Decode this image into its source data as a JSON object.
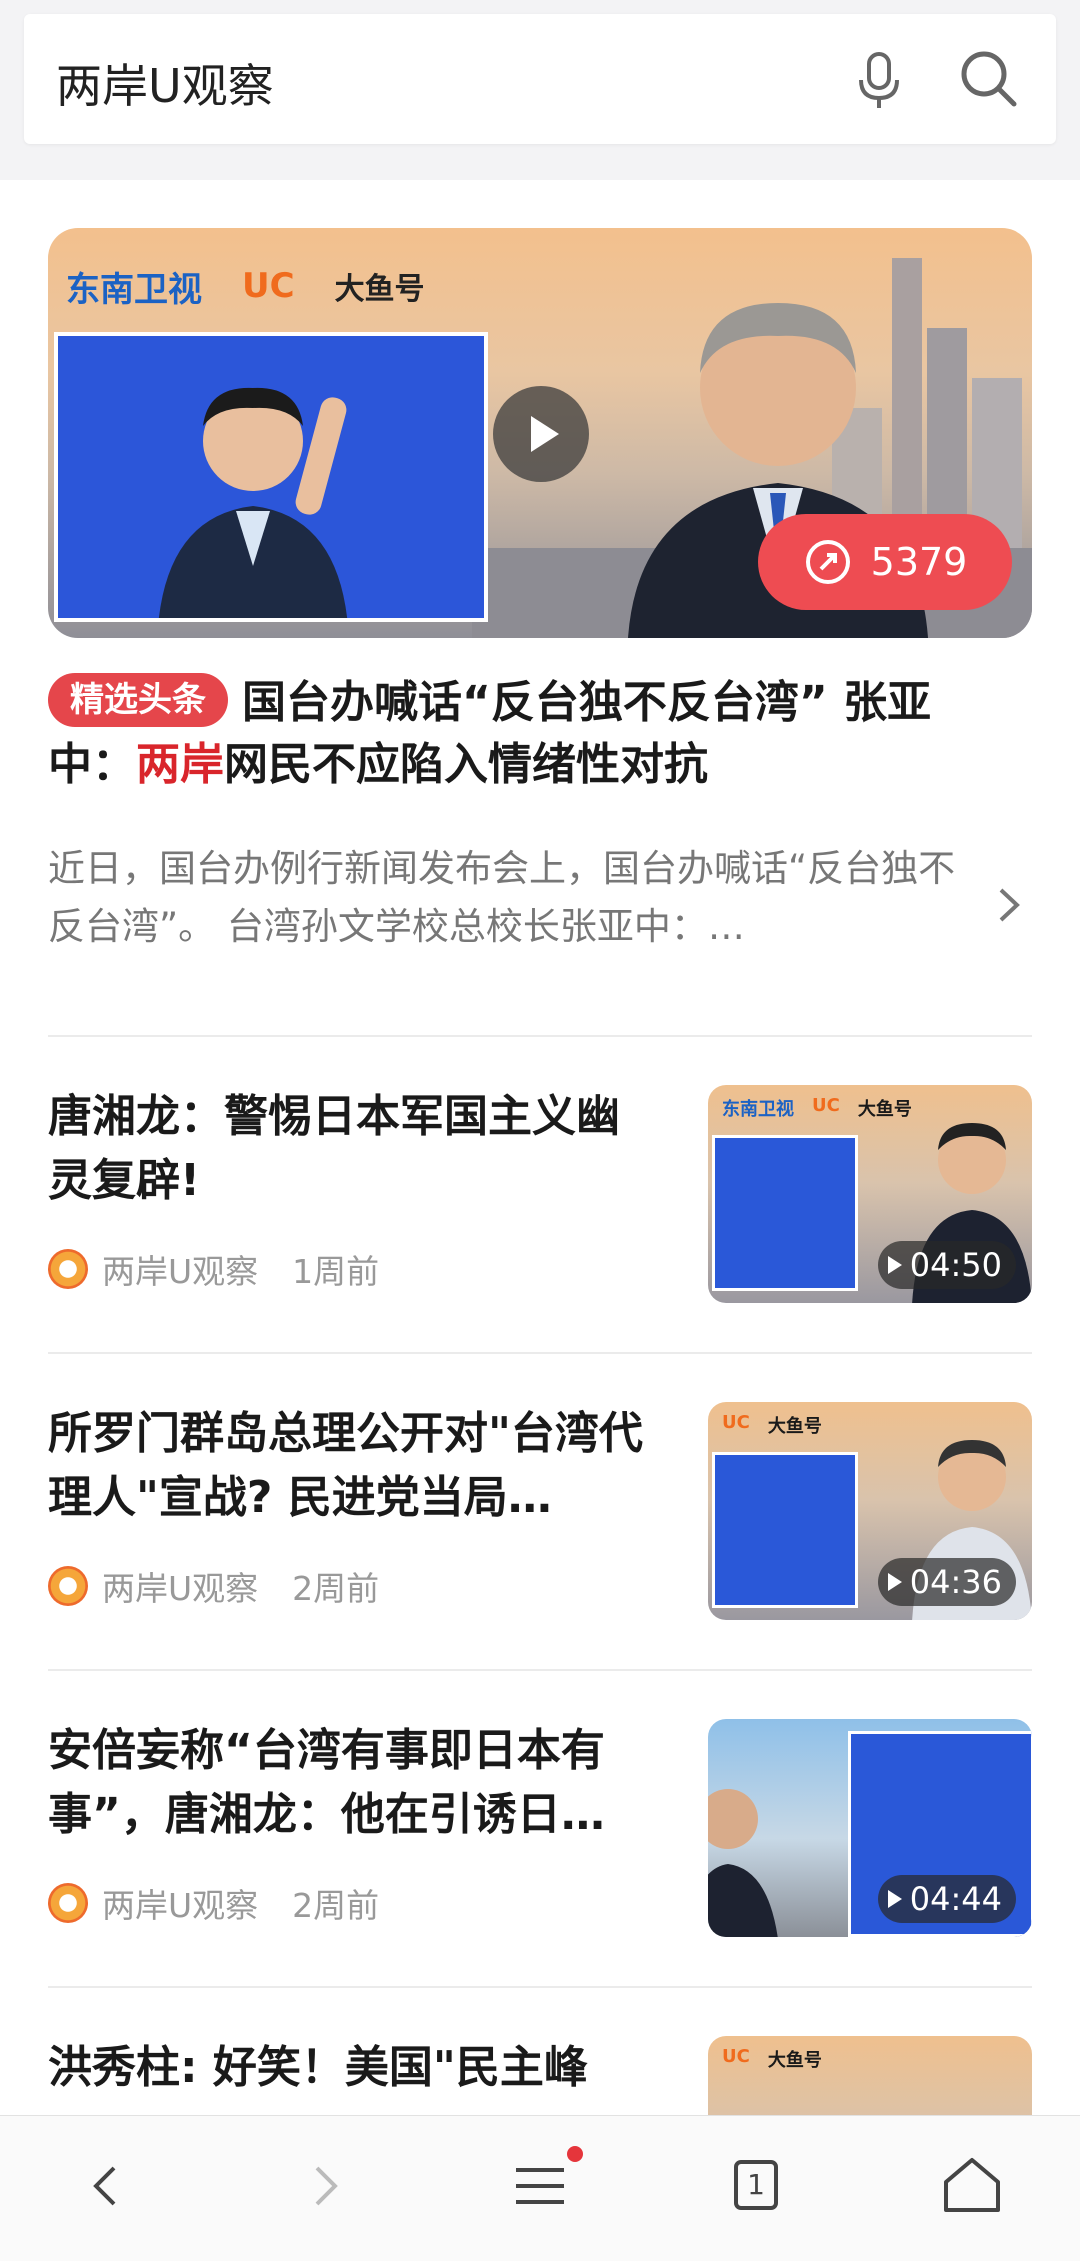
{
  "search": {
    "query": "两岸U观察"
  },
  "hero": {
    "logos": {
      "dongnan": "东南卫视",
      "uc": "UC",
      "dayu": "大鱼号"
    },
    "share_count": "5379",
    "tag": "精选头条",
    "title_part1": "国台办喊话“反台独不反台湾” 张亚中：",
    "title_highlight": "两岸",
    "title_part2": "网民不应陷入情绪性对抗",
    "summary": "近日，国台办例行新闻发布会上，国台办喊话“反台独不反台湾”。 台湾孙文学校总校长张亚中：…"
  },
  "items": [
    {
      "title": "唐湘龙：警惕日本军国主义幽灵复辟!",
      "source": "两岸U观察",
      "time": "1周前",
      "duration": "04:50"
    },
    {
      "title": "所罗门群岛总理公开对\"台湾代理人\"宣战? 民进党当局…",
      "source": "两岸U观察",
      "time": "2周前",
      "duration": "04:36"
    },
    {
      "title": "安倍妄称“台湾有事即日本有事”，唐湘龙：他在引诱日…",
      "source": "两岸U观察",
      "time": "2周前",
      "duration": "04:44"
    },
    {
      "title": "洪秀柱: 好笑！美国\"民主峰",
      "source": "",
      "time": "",
      "duration": ""
    }
  ],
  "bottom_nav": {
    "tab_count": "1"
  },
  "colors": {
    "accent_red": "#e5464b",
    "highlight_red": "#d9252b",
    "meta_gray": "#999999"
  }
}
